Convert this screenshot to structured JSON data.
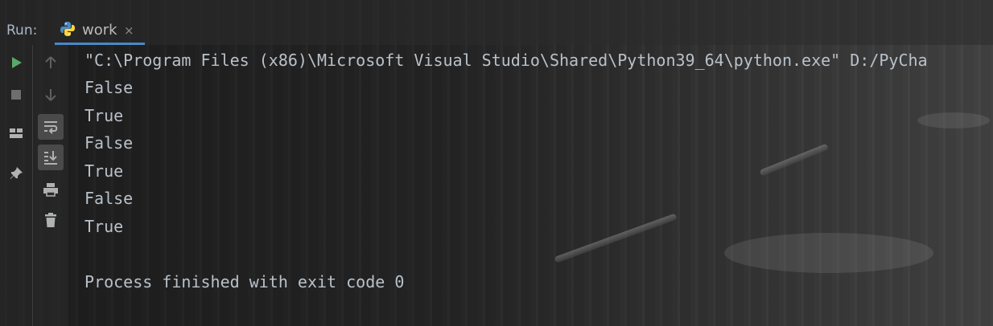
{
  "run_panel": {
    "label": "Run:",
    "tab": {
      "label": "work",
      "close": "×",
      "icon": "python-icon"
    }
  },
  "toolbar_primary": [
    {
      "name": "rerun-button",
      "icon": "play-icon",
      "color": "#59a869"
    },
    {
      "name": "stop-button",
      "icon": "stop-icon",
      "color": "#6e6e6e"
    },
    {
      "name": "layout-button",
      "icon": "layout-icon",
      "color": "#afb1b3"
    },
    {
      "name": "pin-tab-button",
      "icon": "pin-icon",
      "color": "#afb1b3"
    }
  ],
  "toolbar_secondary": [
    {
      "name": "up-stack-button",
      "icon": "arrow-up-icon",
      "color": "#5f6062"
    },
    {
      "name": "down-stack-button",
      "icon": "arrow-down-icon",
      "color": "#5f6062"
    },
    {
      "name": "soft-wrap-button",
      "icon": "soft-wrap-icon",
      "color": "#afb1b3"
    },
    {
      "name": "scroll-to-end-button",
      "icon": "scroll-to-end-icon",
      "color": "#afb1b3"
    },
    {
      "name": "print-button",
      "icon": "printer-icon",
      "color": "#afb1b3"
    },
    {
      "name": "clear-all-button",
      "icon": "trash-icon",
      "color": "#afb1b3"
    }
  ],
  "console": {
    "lines": [
      "\"C:\\Program Files (x86)\\Microsoft Visual Studio\\Shared\\Python39_64\\python.exe\" D:/PyCha",
      "False",
      "True",
      "False",
      "True",
      "False",
      "True",
      "",
      "Process finished with exit code 0"
    ]
  },
  "colors": {
    "accent": "#4a88c7",
    "text": "#b9c1c9",
    "run_green": "#59a869"
  }
}
